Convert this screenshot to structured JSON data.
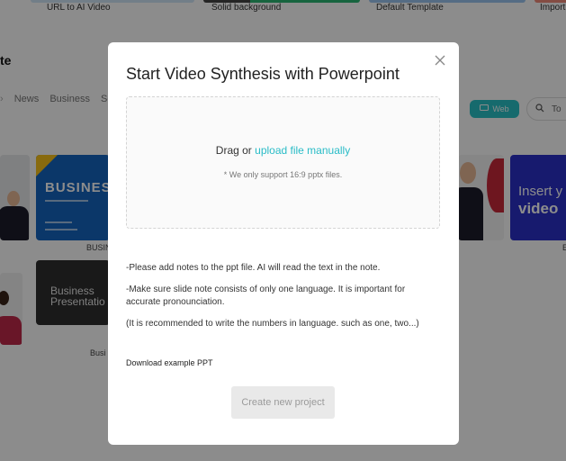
{
  "background": {
    "top_cards": [
      {
        "label": "URL to AI Video",
        "strip_color": "#cfe6f7"
      },
      {
        "label": "Solid background",
        "strip_color": "#2bb673"
      },
      {
        "label": "Default Template",
        "strip_color": "#9cc5f0"
      },
      {
        "label": "Import ",
        "strip_color": "#f08a7a"
      }
    ],
    "page_title_fragment": "te",
    "categories": [
      "News",
      "Business",
      "Sole"
    ],
    "web_toggle_label": "Web",
    "search_fragment": "To",
    "thumbnails": {
      "business_text": "BUSINES",
      "business_caption": "BUSIN",
      "presentation_line1": "Business",
      "presentation_line2": "Presentatio",
      "presentation_caption": "Busi",
      "insert_line1": "Insert y",
      "insert_line2": "video",
      "insert_caption": "E"
    },
    "colors": {
      "accent": "#29bcc7",
      "web_pill": "#29c2c6"
    }
  },
  "modal": {
    "title": "Start Video Synthesis with Powerpoint",
    "upload": {
      "prefix": "Drag or ",
      "link": "upload file manually",
      "note": "* We only support 16:9 pptx files."
    },
    "notes": [
      "-Please add notes to the ppt file. AI will read the text in the note.",
      "-Make sure slide note consists of only one language. It is important for accurate pronounciation.",
      "(It is recommended to write the numbers in language. such as one, two...)"
    ],
    "download_link": "Download example PPT",
    "create_button": "Create new project"
  }
}
